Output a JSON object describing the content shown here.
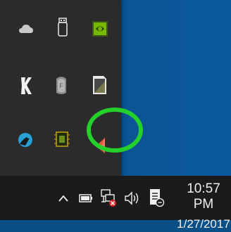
{
  "tray_overflow": {
    "icons": [
      {
        "name": "onedrive-icon"
      },
      {
        "name": "usb-drive-icon"
      },
      {
        "name": "nvidia-icon"
      },
      {
        "name": "killer-network-icon"
      },
      {
        "name": "fingerprint-icon"
      },
      {
        "name": "card-reader-icon"
      },
      {
        "name": "bluetooth-icon"
      },
      {
        "name": "processor-icon"
      },
      {
        "name": "speaker-icon"
      }
    ],
    "highlight_color": "#23d12a"
  },
  "taskbar": {
    "icons": [
      {
        "name": "show-hidden-icons-chevron-icon"
      },
      {
        "name": "battery-icon"
      },
      {
        "name": "network-disconnected-icon"
      },
      {
        "name": "volume-icon"
      },
      {
        "name": "action-center-icon"
      }
    ],
    "clock": {
      "time": "10:57 PM",
      "date": "1/27/2017"
    }
  }
}
